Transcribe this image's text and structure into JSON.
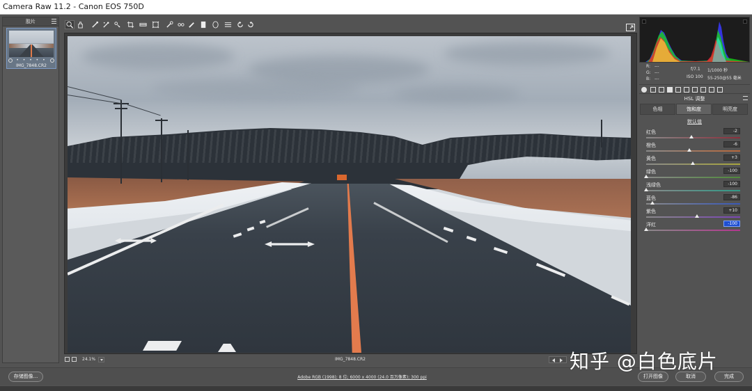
{
  "window": {
    "title": "Camera Raw 11.2 -  Canon EOS 750D"
  },
  "filmstrip": {
    "label": "胶片",
    "thumbnail": {
      "stars": "• • • • •",
      "filename": "IMG_7848.CR2"
    }
  },
  "toolbar": {
    "tools": [
      {
        "name": "zoom-tool-icon",
        "selected": true
      },
      {
        "name": "hand-tool-icon"
      },
      {
        "name": "white-balance-tool-icon"
      },
      {
        "name": "color-sampler-tool-icon"
      },
      {
        "name": "targeted-adjustment-tool-icon"
      },
      {
        "name": "crop-tool-icon"
      },
      {
        "name": "straighten-tool-icon"
      },
      {
        "name": "transform-tool-icon"
      },
      {
        "name": "spot-removal-tool-icon"
      },
      {
        "name": "red-eye-removal-icon"
      },
      {
        "name": "adjustment-brush-icon"
      },
      {
        "name": "graduated-filter-icon"
      },
      {
        "name": "radial-filter-icon"
      },
      {
        "name": "presets-list-icon"
      },
      {
        "name": "rotate-left-icon"
      },
      {
        "name": "rotate-right-icon"
      }
    ],
    "fullscreen_icon": "fullscreen-icon"
  },
  "exif": {
    "r_label": "R:",
    "g_label": "G:",
    "b_label": "B:",
    "r_val": "---",
    "g_val": "---",
    "b_val": "---",
    "aperture": "f/7.1",
    "shutter": "1/1000 秒",
    "iso": "ISO 100",
    "lens": "55-250@55 毫米"
  },
  "panel": {
    "title": "HSL 调整",
    "tabs": [
      {
        "label": "色相",
        "active": false
      },
      {
        "label": "饱和度",
        "active": true
      },
      {
        "label": "明亮度",
        "active": false
      }
    ],
    "subheading": "默认值",
    "sliders": [
      {
        "name": "红色",
        "value": "-2",
        "pos": 0.49,
        "track": "#8b2d3a",
        "active": false
      },
      {
        "name": "橙色",
        "value": "-6",
        "pos": 0.47,
        "track": "#b9683a",
        "active": false
      },
      {
        "name": "黄色",
        "value": "+3",
        "pos": 0.51,
        "track": "#a8a53c",
        "active": false
      },
      {
        "name": "绿色",
        "value": "-100",
        "pos": 0.0,
        "track": "#4f8a3a",
        "active": false
      },
      {
        "name": "浅绿色",
        "value": "-100",
        "pos": 0.0,
        "track": "#2f9a88",
        "active": false
      },
      {
        "name": "蓝色",
        "value": "-86",
        "pos": 0.07,
        "track": "#3858b8",
        "active": false
      },
      {
        "name": "紫色",
        "value": "+10",
        "pos": 0.55,
        "track": "#7a44b6",
        "active": false
      },
      {
        "name": "洋红",
        "value": "-100",
        "pos": 0.0,
        "track": "#b4368f",
        "active": true
      }
    ]
  },
  "status": {
    "zoom": "24.1%",
    "filename": "IMG_7848.CR2"
  },
  "bottom": {
    "save_label": "存储图像...",
    "workflow": "Adobe RGB (1998); 8 位; 6000 x 4000 (24.0 百万像素); 300 ppi",
    "open_label": "打开图像",
    "cancel_label": "取消",
    "done_label": "完成"
  },
  "watermark": "知乎 @白色底片"
}
